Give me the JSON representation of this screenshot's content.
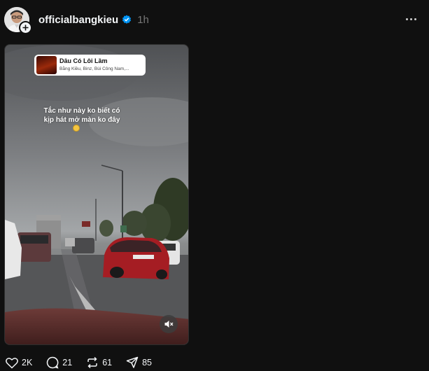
{
  "post": {
    "username": "officialbangkieu",
    "time": "1h",
    "verified_icon": "verified-badge-icon",
    "more_icon": "more-options-icon"
  },
  "media": {
    "music": {
      "title": "Dẫu Có Lỗi Lầm",
      "artists": "Bằng Kiều, Binz, Bùi Công Nam,..."
    },
    "caption_line1": "Tắc như này ko biết có",
    "caption_line2": "kịp hát mở màn ko đây",
    "mute_icon": "muted-speaker-icon"
  },
  "actions": {
    "likes": "2K",
    "comments": "21",
    "reposts": "61",
    "shares": "85"
  },
  "colors": {
    "background": "#101010",
    "text": "#f3f5f7",
    "muted": "#777777",
    "verified": "#0095f6"
  }
}
